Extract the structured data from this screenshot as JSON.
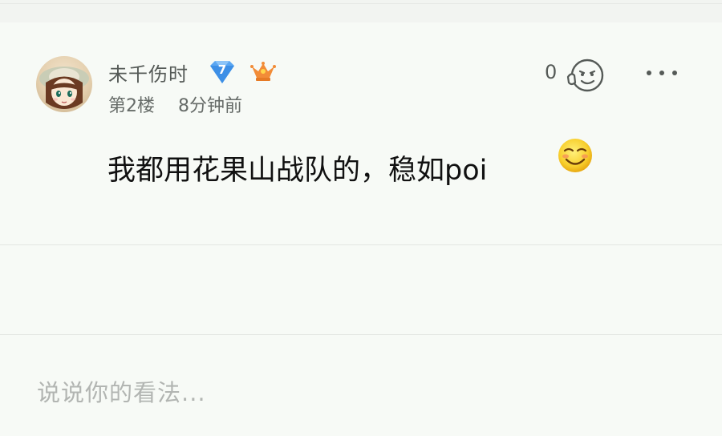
{
  "comment": {
    "username": "未千伤时",
    "level": "7",
    "floor": "第2楼",
    "time": "8分钟前",
    "like_count": "0",
    "content": "我都用花果山战队的，稳如poi",
    "icons": {
      "level_badge": "diamond-level-icon",
      "vip_badge": "vip-crown-icon",
      "like": "like-face-icon",
      "more": "more-dots-icon",
      "emoji": "smile-emoji-icon"
    },
    "colors": {
      "level_badge": "#5aa6f2",
      "vip_badge": "#f28c38",
      "text_primary": "#111111",
      "text_secondary": "#666b68",
      "placeholder": "#b2b5b2"
    }
  },
  "footer": {
    "placeholder": "说说你的看法..."
  }
}
